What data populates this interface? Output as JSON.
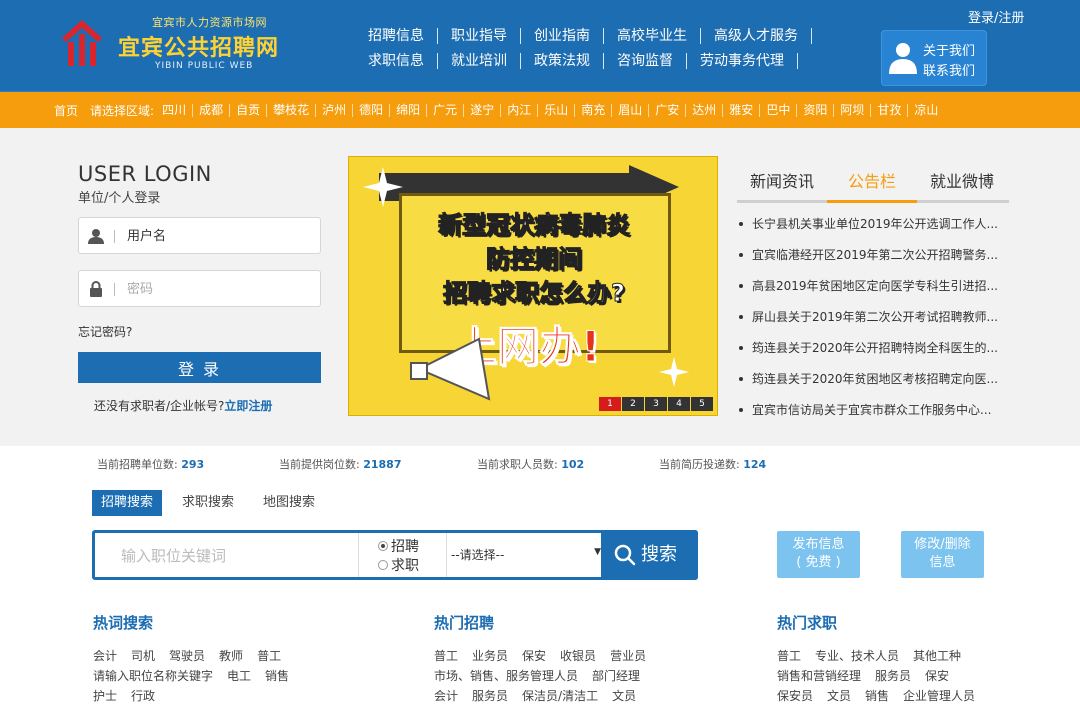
{
  "header": {
    "logo_top": "宜宾市人力资源市场网",
    "logo_main": "宜宾公共招聘网",
    "logo_en": "YIBIN PUBLIC WEB",
    "nav_row1": [
      "招聘信息",
      "职业指导",
      "创业指南",
      "高校毕业生",
      "高级人才服务"
    ],
    "nav_row2": [
      "求职信息",
      "就业培训",
      "政策法规",
      "咨询监督",
      "劳动事务代理"
    ],
    "login_register": "登录/注册",
    "about_us": "关于我们",
    "contact_us": "联系我们"
  },
  "regions": {
    "home": "首页",
    "select": "请选择区域:",
    "items": [
      "四川",
      "成都",
      "自贡",
      "攀枝花",
      "泸州",
      "德阳",
      "绵阳",
      "广元",
      "遂宁",
      "内江",
      "乐山",
      "南充",
      "眉山",
      "广安",
      "达州",
      "雅安",
      "巴中",
      "资阳",
      "阿坝",
      "甘孜",
      "凉山"
    ]
  },
  "login": {
    "title": "USER LOGIN",
    "subtitle": "单位/个人登录",
    "username_placeholder": "用户名",
    "password_placeholder": "密码",
    "forgot": "忘记密码?",
    "submit": "登 录",
    "no_account": "还没有求职者/企业帐号?",
    "register_now": "立即注册"
  },
  "banner": {
    "line1": "新型冠状病毒肺炎",
    "line2": "防控期间",
    "line3": "招聘求职怎么办?",
    "big": "上网办!",
    "pages": [
      "1",
      "2",
      "3",
      "4",
      "5"
    ],
    "active_page": 0
  },
  "news_tabs": [
    "新闻资讯",
    "公告栏",
    "就业微博"
  ],
  "news_active": 1,
  "news": [
    "长宁县机关事业单位2019年公开选调工作人...",
    "宜宾临港经开区2019年第二次公开招聘警务...",
    "高县2019年贫困地区定向医学专科生引进招...",
    "屏山县关于2019年第二次公开考试招聘教师...",
    "筠连县关于2020年公开招聘特岗全科医生的...",
    "筠连县关于2020年贫困地区考核招聘定向医...",
    "宜宾市信访局关于宜宾市群众工作服务中心..."
  ],
  "stats": {
    "units_label": "当前招聘单位数:",
    "units": "293",
    "posts_label": "当前提供岗位数:",
    "posts": "21887",
    "seekers_label": "当前求职人员数:",
    "seekers": "102",
    "resumes_label": "当前简历投递数:",
    "resumes": "124"
  },
  "search": {
    "tabs": [
      "招聘搜索",
      "求职搜索",
      "地图搜索"
    ],
    "placeholder": "输入职位关键词",
    "radio1": "招聘",
    "radio2": "求职",
    "select": "--请选择--",
    "button": "搜索",
    "publish_l1": "发布信息",
    "publish_l2": "( 免费 )",
    "modify_l1": "修改/删除",
    "modify_l2": "信息"
  },
  "hot_search": {
    "title": "热词搜索",
    "rows": [
      [
        "会计",
        "司机",
        "驾驶员",
        "教师",
        "普工"
      ],
      [
        "请输入职位名称关键字",
        "电工",
        "销售"
      ],
      [
        "护士",
        "行政"
      ]
    ]
  },
  "hot_jobs": {
    "title": "热门招聘",
    "rows": [
      [
        "普工",
        "业务员",
        "保安",
        "收银员",
        "营业员"
      ],
      [
        "市场、销售、服务管理人员",
        "部门经理"
      ],
      [
        "会计",
        "服务员",
        "保洁员/清洁工",
        "文员"
      ]
    ]
  },
  "hot_seek": {
    "title": "热门求职",
    "rows": [
      [
        "普工",
        "专业、技术人员",
        "其他工种"
      ],
      [
        "销售和营销经理",
        "服务员",
        "保安"
      ],
      [
        "保安员",
        "文员",
        "销售",
        "企业管理人员"
      ]
    ]
  },
  "colors": {
    "primary": "#1d6db2",
    "orange": "#f59d0c",
    "light_blue": "#7cc3ef"
  }
}
